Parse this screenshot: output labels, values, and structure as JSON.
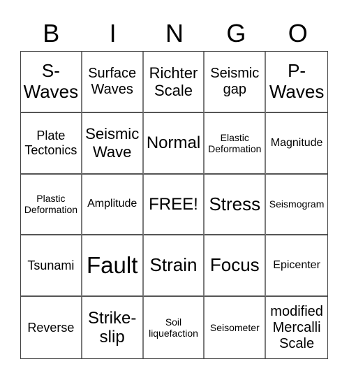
{
  "header": [
    "B",
    "I",
    "N",
    "G",
    "O"
  ],
  "cells": [
    [
      "S-\nWaves",
      "Surface\nWaves",
      "Richter\nScale",
      "Seismic\ngap",
      "P-\nWaves"
    ],
    [
      "Plate\nTectonics",
      "Seismic\nWave",
      "Normal",
      "Elastic\nDeformation",
      "Magnitude"
    ],
    [
      "Plastic\nDeformation",
      "Amplitude",
      "FREE!",
      "Stress",
      "Seismogram"
    ],
    [
      "Tsunami",
      "Fault",
      "Strain",
      "Focus",
      "Epicenter"
    ],
    [
      "Reverse",
      "Strike-\nslip",
      "Soil\nliquefaction",
      "Seisometer",
      "modified\nMercalli\nScale"
    ]
  ]
}
